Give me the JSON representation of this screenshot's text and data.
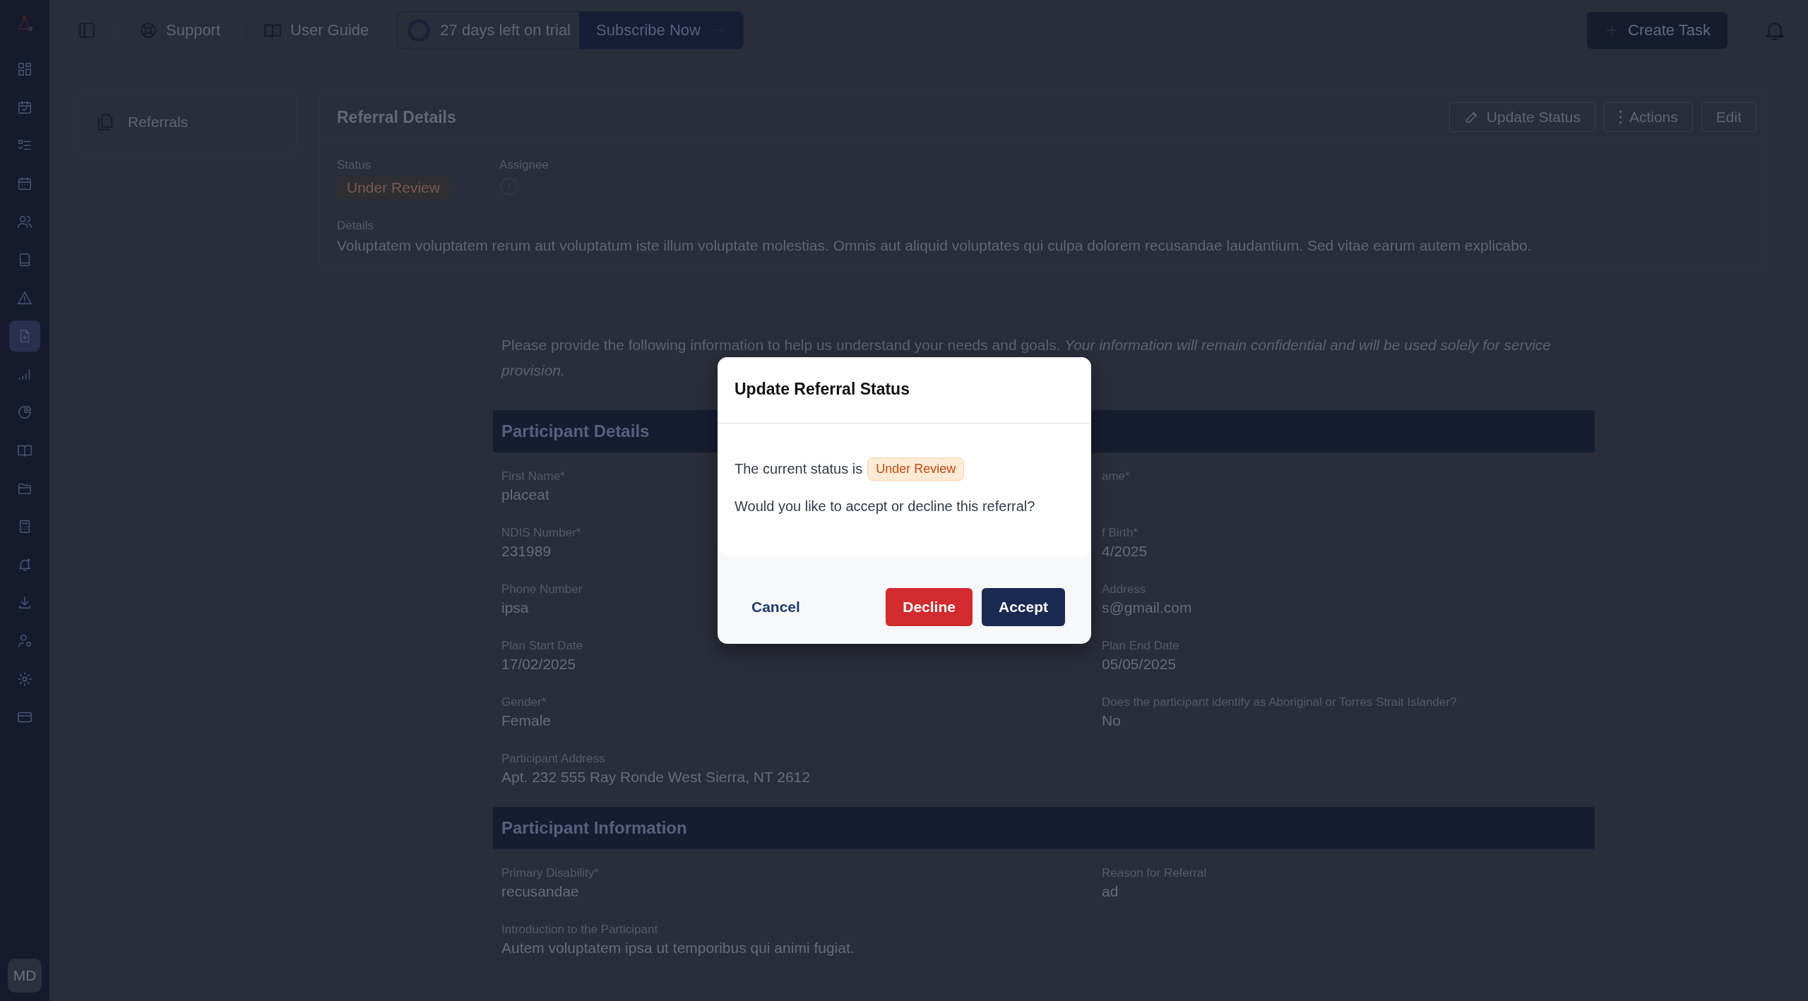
{
  "sidebar": {
    "items": [
      {
        "selected": false
      },
      {
        "selected": false
      },
      {
        "selected": false
      },
      {
        "selected": false
      },
      {
        "selected": false
      },
      {
        "selected": false
      },
      {
        "selected": false
      },
      {
        "selected": true
      },
      {
        "selected": false
      },
      {
        "selected": false
      },
      {
        "selected": false
      },
      {
        "selected": false
      },
      {
        "selected": false
      },
      {
        "selected": false
      },
      {
        "selected": false
      },
      {
        "selected": false
      },
      {
        "selected": false
      },
      {
        "selected": false
      }
    ],
    "avatar": "MD"
  },
  "topbar": {
    "support": "Support",
    "guide": "User Guide",
    "trial": "27 days left on trial",
    "subscribe": "Subscribe Now",
    "create_task": "Create Task"
  },
  "nav": {
    "items": [
      {
        "label": "Referrals"
      }
    ]
  },
  "referral": {
    "title": "Referral Details",
    "actions": [
      "Update Status",
      "Actions",
      "Edit"
    ],
    "status_label": "Status",
    "status": "Under Review",
    "assignee_label": "Assignee",
    "details_label": "Details",
    "details": "Voluptatem voluptatem rerum aut voluptatum iste illum voluptate molestias. Omnis aut aliquid voluptates qui culpa dolorem recusandae laudantium. Sed vitae earum autem explicabo."
  },
  "form": {
    "intro": "Please provide the following information to help us understand your needs and goals. *Your information will remain confidential and will be used solely for service provision.*",
    "sections": [
      {
        "title": "Participant Details",
        "fields": [
          {
            "label": "First Name*",
            "value": "placeat"
          },
          {
            "label": "ame*"
          },
          {
            "label": "NDIS Number*",
            "value": "231989"
          },
          {
            "label": "f Birth*",
            "value": "4/2025"
          },
          {
            "label": "Phone Number",
            "value": "ipsa"
          },
          {
            "label": "Address",
            "value": "s@gmail.com"
          },
          {
            "label": "Plan Start Date",
            "value": "17/02/2025"
          },
          {
            "label": "Plan End Date",
            "value": "05/05/2025"
          },
          {
            "label": "Gender*",
            "value": "Female"
          },
          {
            "label": "Does the participant identify as Aboriginal or Torres Strait Islander?",
            "value": "No"
          },
          {
            "label": "Participant Address",
            "value": "Apt. 232 555 Ray Ronde West Sierra, NT 2612"
          }
        ]
      },
      {
        "title": "Participant Information",
        "fields": [
          {
            "label": "Primary Disability*",
            "value": "recusandae"
          },
          {
            "label": "Reason for Referral",
            "value": "ad"
          },
          {
            "label": "Introduction to the Participant",
            "value": "Autem voluptatem ipsa ut temporibus qui animi fugiat."
          }
        ]
      }
    ]
  },
  "modal": {
    "title": "Update Referral Status",
    "status_text": "The current status is",
    "status": "Under Review",
    "question": "Would you like to accept or decline this referral?",
    "cancel": "Cancel",
    "decline": "Decline",
    "accept": "Accept"
  }
}
